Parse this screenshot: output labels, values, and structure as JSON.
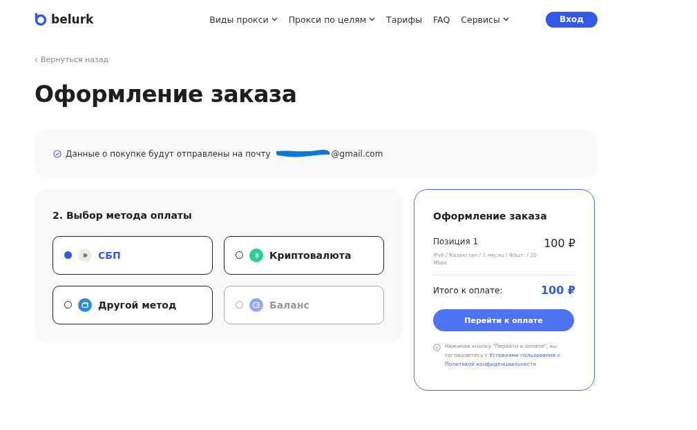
{
  "header": {
    "logo": "belurk",
    "nav": [
      {
        "label": "Виды прокси",
        "dropdown": true
      },
      {
        "label": "Прокси по целям",
        "dropdown": true
      },
      {
        "label": "Тарифы",
        "dropdown": false
      },
      {
        "label": "FAQ",
        "dropdown": false
      },
      {
        "label": "Сервисы",
        "dropdown": true
      }
    ],
    "login_button": "Вход"
  },
  "back_link": "Вернуться назад",
  "title": "Оформление заказа",
  "notice": {
    "text": "Данные о покупке будут отправлены на почту",
    "email_visible": "@gmail.com"
  },
  "payment": {
    "heading": "2. Выбор метода оплаты",
    "methods": [
      {
        "label": "СБП",
        "kind": "sbp",
        "selected": true,
        "disabled": false,
        "color": "#ececf0"
      },
      {
        "label": "Криптовалюта",
        "kind": "crypto",
        "selected": false,
        "disabled": false,
        "color": "#2ecf8e"
      },
      {
        "label": "Другой метод",
        "kind": "card",
        "selected": false,
        "disabled": false,
        "color": "#2a8fd1"
      },
      {
        "label": "Баланс",
        "kind": "wallet",
        "selected": false,
        "disabled": true,
        "color": "#9aa6ef"
      }
    ]
  },
  "summary": {
    "title": "Оформление заказа",
    "position": {
      "name": "Позиция 1",
      "details": "IPv6 / Казахстан / 1 месяц / 40шт. / 20 Mbps",
      "price": "100 ₽"
    },
    "total_label": "Итого к оплате:",
    "total": "100 ₽",
    "pay_button": "Перейти к оплате",
    "terms": {
      "before": "Нажимая кнопку \"Перейти к оплате\", вы соглашаетесь с",
      "link1": "Условиями пользования",
      "middle": "и",
      "link2": "Политикой конфиденциальности"
    }
  }
}
